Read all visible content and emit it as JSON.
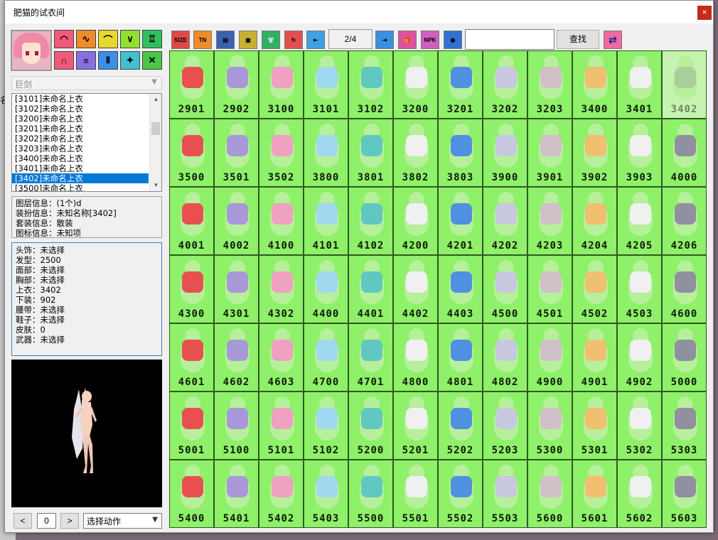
{
  "window": {
    "title": "肥猫的试衣间",
    "close_glyph": "×"
  },
  "background": {
    "left_text": "名"
  },
  "left_panel": {
    "category_buttons": [
      {
        "glyph": "◠",
        "color": "#f05a78"
      },
      {
        "glyph": "∿",
        "color": "#f08c28"
      },
      {
        "glyph": "⌒",
        "color": "#e8d82c"
      },
      {
        "glyph": "∨",
        "color": "#90e030"
      },
      {
        "glyph": "♖",
        "color": "#30c060"
      },
      {
        "glyph": "∩",
        "color": "#f05a78"
      },
      {
        "glyph": "≡",
        "color": "#8870e0"
      },
      {
        "glyph": "Ⅱ",
        "color": "#3a90e8"
      },
      {
        "glyph": "✦",
        "color": "#40c0d0"
      },
      {
        "glyph": "✕",
        "color": "#48c848"
      }
    ],
    "weapon_combo": "巨剑",
    "list_items": [
      "[3101]未命名上衣",
      "[3102]未命名上衣",
      "[3200]未命名上衣",
      "[3201]未命名上衣",
      "[3202]未命名上衣",
      "[3203]未命名上衣",
      "[3400]未命名上衣",
      "[3401]未命名上衣",
      "[3402]未命名上衣",
      "[3500]未命名上衣"
    ],
    "selected_index": 8,
    "info_lines": [
      "图层信息：(1个)d",
      "装扮信息：未知名称[3402]",
      "套装信息：散装",
      "图标信息：未知项"
    ],
    "part_lines": [
      "头饰：未选择",
      "发型：2500",
      "面部：未选择",
      "胸部：未选择",
      "上衣：3402",
      "下装：902",
      "腰带：未选择",
      "鞋子：未选择",
      "皮肤：0",
      "武器：未选择"
    ],
    "prev_label": "<",
    "frame_value": "0",
    "next_label": ">",
    "action_select": "选择动作"
  },
  "toolbar": {
    "buttons": [
      {
        "name": "size-icon",
        "label": "SIZE",
        "color": "#e04848"
      },
      {
        "name": "tn-icon",
        "label": "TN",
        "color": "#f08a2a"
      },
      {
        "name": "book-icon",
        "label": "▤",
        "color": "#3a60b0"
      },
      {
        "name": "frame-icon",
        "label": "▣",
        "color": "#c8b030"
      },
      {
        "name": "shirt-icon",
        "label": "👕",
        "color": "#30b060"
      },
      {
        "name": "refresh-icon",
        "label": "↻",
        "color": "#e05050"
      },
      {
        "name": "back-icon",
        "label": "⇤",
        "color": "#40a0e0"
      }
    ],
    "page_indicator": "2/4",
    "buttons_right": [
      {
        "name": "export-icon",
        "label": "⇥",
        "color": "#3a90e0"
      },
      {
        "name": "gift-icon",
        "label": "🎁",
        "color": "#e050a0"
      },
      {
        "name": "npk-icon",
        "label": "NPK",
        "color": "#d060c0"
      },
      {
        "name": "globe-icon",
        "label": "◉",
        "color": "#3070d0"
      }
    ],
    "search_value": "",
    "find_label": "查找",
    "shuffle_icon": "⇄"
  },
  "grid_items": [
    "2901",
    "2902",
    "3100",
    "3101",
    "3102",
    "3200",
    "3201",
    "3202",
    "3203",
    "3400",
    "3401",
    "3402",
    "3500",
    "3501",
    "3502",
    "3800",
    "3801",
    "3802",
    "3803",
    "3900",
    "3901",
    "3902",
    "3903",
    "4000",
    "4001",
    "4002",
    "4100",
    "4101",
    "4102",
    "4200",
    "4201",
    "4202",
    "4203",
    "4204",
    "4205",
    "4206",
    "4300",
    "4301",
    "4302",
    "4400",
    "4401",
    "4402",
    "4403",
    "4500",
    "4501",
    "4502",
    "4503",
    "4600",
    "4601",
    "4602",
    "4603",
    "4700",
    "4701",
    "4800",
    "4801",
    "4802",
    "4900",
    "4901",
    "4902",
    "5000",
    "5001",
    "5100",
    "5101",
    "5102",
    "5200",
    "5201",
    "5202",
    "5203",
    "5300",
    "5301",
    "5302",
    "5303",
    "5400",
    "5401",
    "5402",
    "5403",
    "5500",
    "5501",
    "5502",
    "5503",
    "5600",
    "5601",
    "5602",
    "5603"
  ],
  "highlighted_item": "3402"
}
